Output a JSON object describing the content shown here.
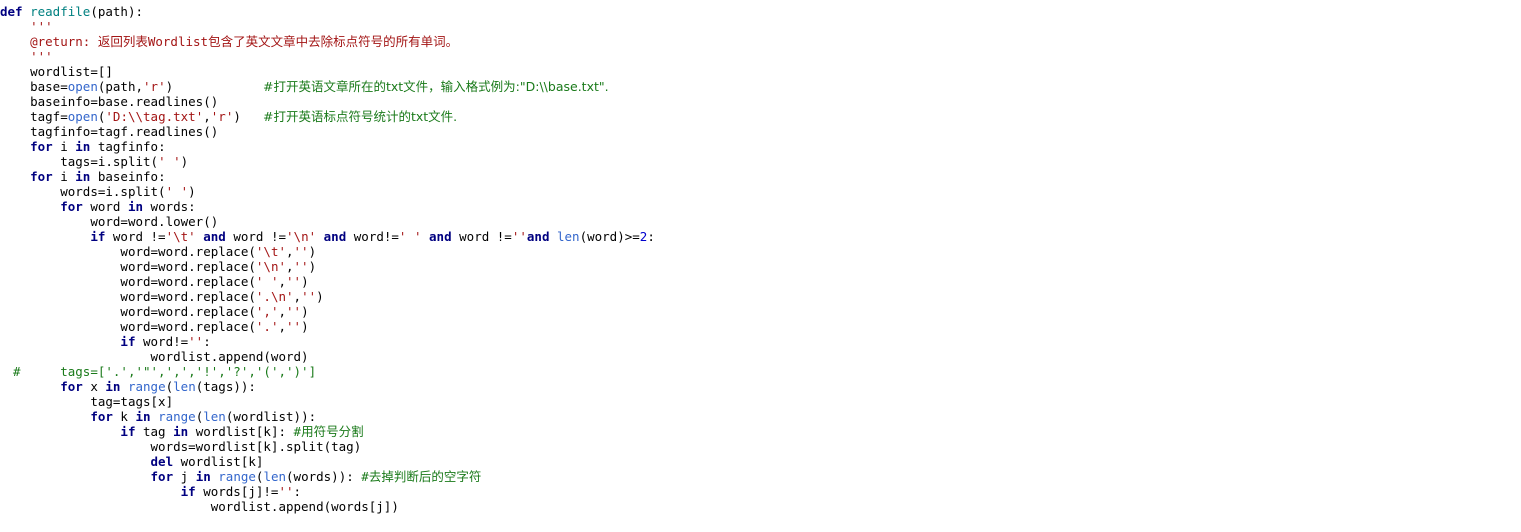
{
  "document": {
    "kind": "python-source-listing",
    "language": "Python",
    "background_color": "#ffffff",
    "colors": {
      "keyword": "#000080",
      "function_name": "#008080",
      "builtin": "#3366cc",
      "string": "#a31515",
      "docstring": "#a31515",
      "comment": "#1a7a1a",
      "number": "#0000cd",
      "plain_text": "#000000"
    }
  },
  "code": {
    "lines": [
      {
        "indent": "",
        "tokens": [
          {
            "t": "def ",
            "c": "kw"
          },
          {
            "t": "readfile",
            "c": "fn"
          },
          {
            "t": "(path):",
            "c": "plain"
          }
        ]
      },
      {
        "indent": "    ",
        "tokens": [
          {
            "t": "'''",
            "c": "doc"
          }
        ]
      },
      {
        "indent": "    ",
        "tokens": [
          {
            "t": "@return: ",
            "c": "doc"
          },
          {
            "t": "返回列表",
            "c": "doc-cn"
          },
          {
            "t": "Wordlist",
            "c": "doc"
          },
          {
            "t": "包含了英文文章中去除标点符号的所有单词。",
            "c": "doc-cn"
          }
        ]
      },
      {
        "indent": "    ",
        "tokens": [
          {
            "t": "'''",
            "c": "doc"
          }
        ]
      },
      {
        "indent": "    ",
        "tokens": [
          {
            "t": "wordlist=[]",
            "c": "plain"
          }
        ]
      },
      {
        "indent": "    ",
        "tokens": [
          {
            "t": "base=",
            "c": "plain"
          },
          {
            "t": "open",
            "c": "builtin"
          },
          {
            "t": "(path,",
            "c": "plain"
          },
          {
            "t": "'r'",
            "c": "str"
          },
          {
            "t": ")",
            "c": "plain"
          }
        ],
        "comment": {
          "text": "#打开英语文章所在的txt文件，输入格式例为:\"D:\\\\base.txt\".",
          "col": "tail-c1"
        }
      },
      {
        "indent": "    ",
        "tokens": [
          {
            "t": "baseinfo=base.readlines()",
            "c": "plain"
          }
        ]
      },
      {
        "indent": "    ",
        "tokens": [
          {
            "t": "tagf=",
            "c": "plain"
          },
          {
            "t": "open",
            "c": "builtin"
          },
          {
            "t": "(",
            "c": "plain"
          },
          {
            "t": "'D:\\\\tag.txt'",
            "c": "str"
          },
          {
            "t": ",",
            "c": "plain"
          },
          {
            "t": "'r'",
            "c": "str"
          },
          {
            "t": ")",
            "c": "plain"
          }
        ],
        "comment": {
          "text": "#打开英语标点符号统计的txt文件.",
          "col": "tail-c2"
        }
      },
      {
        "indent": "    ",
        "tokens": [
          {
            "t": "tagfinfo=tagf.readlines()",
            "c": "plain"
          }
        ]
      },
      {
        "indent": "    ",
        "tokens": [
          {
            "t": "for ",
            "c": "kw"
          },
          {
            "t": "i ",
            "c": "plain"
          },
          {
            "t": "in ",
            "c": "kw"
          },
          {
            "t": "tagfinfo:",
            "c": "plain"
          }
        ]
      },
      {
        "indent": "        ",
        "tokens": [
          {
            "t": "tags=i.split(",
            "c": "plain"
          },
          {
            "t": "' '",
            "c": "str"
          },
          {
            "t": ")",
            "c": "plain"
          }
        ]
      },
      {
        "indent": "    ",
        "tokens": [
          {
            "t": "for ",
            "c": "kw"
          },
          {
            "t": "i ",
            "c": "plain"
          },
          {
            "t": "in ",
            "c": "kw"
          },
          {
            "t": "baseinfo:",
            "c": "plain"
          }
        ]
      },
      {
        "indent": "        ",
        "tokens": [
          {
            "t": "words=i.split(",
            "c": "plain"
          },
          {
            "t": "' '",
            "c": "str"
          },
          {
            "t": ")",
            "c": "plain"
          }
        ]
      },
      {
        "indent": "        ",
        "tokens": [
          {
            "t": "for ",
            "c": "kw"
          },
          {
            "t": "word ",
            "c": "plain"
          },
          {
            "t": "in ",
            "c": "kw"
          },
          {
            "t": "words:",
            "c": "plain"
          }
        ]
      },
      {
        "indent": "            ",
        "tokens": [
          {
            "t": "word=word.lower()",
            "c": "plain"
          }
        ]
      },
      {
        "indent": "            ",
        "tokens": [
          {
            "t": "if ",
            "c": "kw"
          },
          {
            "t": "word !=",
            "c": "plain"
          },
          {
            "t": "'\\t'",
            "c": "str"
          },
          {
            "t": " and ",
            "c": "kw"
          },
          {
            "t": "word !=",
            "c": "plain"
          },
          {
            "t": "'\\n'",
            "c": "str"
          },
          {
            "t": " and ",
            "c": "kw"
          },
          {
            "t": "word!=",
            "c": "plain"
          },
          {
            "t": "' '",
            "c": "str"
          },
          {
            "t": " and ",
            "c": "kw"
          },
          {
            "t": "word !=",
            "c": "plain"
          },
          {
            "t": "''",
            "c": "str"
          },
          {
            "t": "and ",
            "c": "kw"
          },
          {
            "t": "len",
            "c": "builtin"
          },
          {
            "t": "(word)>=",
            "c": "plain"
          },
          {
            "t": "2",
            "c": "num"
          },
          {
            "t": ":",
            "c": "plain"
          }
        ]
      },
      {
        "indent": "                ",
        "tokens": [
          {
            "t": "word=word.replace(",
            "c": "plain"
          },
          {
            "t": "'\\t'",
            "c": "str"
          },
          {
            "t": ",",
            "c": "plain"
          },
          {
            "t": "''",
            "c": "str"
          },
          {
            "t": ")",
            "c": "plain"
          }
        ]
      },
      {
        "indent": "                ",
        "tokens": [
          {
            "t": "word=word.replace(",
            "c": "plain"
          },
          {
            "t": "'\\n'",
            "c": "str"
          },
          {
            "t": ",",
            "c": "plain"
          },
          {
            "t": "''",
            "c": "str"
          },
          {
            "t": ")",
            "c": "plain"
          }
        ]
      },
      {
        "indent": "                ",
        "tokens": [
          {
            "t": "word=word.replace(",
            "c": "plain"
          },
          {
            "t": "' '",
            "c": "str"
          },
          {
            "t": ",",
            "c": "plain"
          },
          {
            "t": "''",
            "c": "str"
          },
          {
            "t": ")",
            "c": "plain"
          }
        ]
      },
      {
        "indent": "                ",
        "tokens": [
          {
            "t": "word=word.replace(",
            "c": "plain"
          },
          {
            "t": "'.\\n'",
            "c": "str"
          },
          {
            "t": ",",
            "c": "plain"
          },
          {
            "t": "''",
            "c": "str"
          },
          {
            "t": ")",
            "c": "plain"
          }
        ]
      },
      {
        "indent": "                ",
        "tokens": [
          {
            "t": "word=word.replace(",
            "c": "plain"
          },
          {
            "t": "','",
            "c": "str"
          },
          {
            "t": ",",
            "c": "plain"
          },
          {
            "t": "''",
            "c": "str"
          },
          {
            "t": ")",
            "c": "plain"
          }
        ]
      },
      {
        "indent": "                ",
        "tokens": [
          {
            "t": "word=word.replace(",
            "c": "plain"
          },
          {
            "t": "'.'",
            "c": "str"
          },
          {
            "t": ",",
            "c": "plain"
          },
          {
            "t": "''",
            "c": "str"
          },
          {
            "t": ")",
            "c": "plain"
          }
        ]
      },
      {
        "indent": "                ",
        "tokens": [
          {
            "t": "if ",
            "c": "kw"
          },
          {
            "t": "word!=",
            "c": "plain"
          },
          {
            "t": "''",
            "c": "str"
          },
          {
            "t": ":",
            "c": "plain"
          }
        ]
      },
      {
        "indent": "                    ",
        "tokens": [
          {
            "t": "wordlist.append(word)",
            "c": "plain"
          }
        ]
      },
      {
        "indent": "        ",
        "gutter_hash": "#",
        "tokens": [
          {
            "t": "tags=[",
            "c": "cmt"
          },
          {
            "t": "'.','\"',',','!','?','(',')'",
            "c": "cmt"
          },
          {
            "t": "]",
            "c": "cmt"
          }
        ]
      },
      {
        "indent": "        ",
        "tokens": [
          {
            "t": "for ",
            "c": "kw"
          },
          {
            "t": "x ",
            "c": "plain"
          },
          {
            "t": "in ",
            "c": "kw"
          },
          {
            "t": "range",
            "c": "builtin"
          },
          {
            "t": "(",
            "c": "plain"
          },
          {
            "t": "len",
            "c": "builtin"
          },
          {
            "t": "(tags)):",
            "c": "plain"
          }
        ]
      },
      {
        "indent": "            ",
        "tokens": [
          {
            "t": "tag=tags[x]",
            "c": "plain"
          }
        ]
      },
      {
        "indent": "            ",
        "tokens": [
          {
            "t": "for ",
            "c": "kw"
          },
          {
            "t": "k ",
            "c": "plain"
          },
          {
            "t": "in ",
            "c": "kw"
          },
          {
            "t": "range",
            "c": "builtin"
          },
          {
            "t": "(",
            "c": "plain"
          },
          {
            "t": "len",
            "c": "builtin"
          },
          {
            "t": "(wordlist)):",
            "c": "plain"
          }
        ]
      },
      {
        "indent": "                ",
        "tokens": [
          {
            "t": "if ",
            "c": "kw"
          },
          {
            "t": "tag ",
            "c": "plain"
          },
          {
            "t": "in ",
            "c": "kw"
          },
          {
            "t": "wordlist[k]: ",
            "c": "plain"
          },
          {
            "t": "#",
            "c": "cmt"
          },
          {
            "t": "用符号分割",
            "c": "cmt-cn"
          }
        ]
      },
      {
        "indent": "                    ",
        "tokens": [
          {
            "t": "words=wordlist[k].split(tag)",
            "c": "plain"
          }
        ]
      },
      {
        "indent": "                    ",
        "tokens": [
          {
            "t": "del ",
            "c": "kw"
          },
          {
            "t": "wordlist[k]",
            "c": "plain"
          }
        ]
      },
      {
        "indent": "                    ",
        "tokens": [
          {
            "t": "for ",
            "c": "kw"
          },
          {
            "t": "j ",
            "c": "plain"
          },
          {
            "t": "in ",
            "c": "kw"
          },
          {
            "t": "range",
            "c": "builtin"
          },
          {
            "t": "(",
            "c": "plain"
          },
          {
            "t": "len",
            "c": "builtin"
          },
          {
            "t": "(words)): ",
            "c": "plain"
          },
          {
            "t": "#",
            "c": "cmt"
          },
          {
            "t": "去掉判断后的空字符",
            "c": "cmt-cn"
          }
        ]
      },
      {
        "indent": "                        ",
        "tokens": [
          {
            "t": "if ",
            "c": "kw"
          },
          {
            "t": "words[j]!=",
            "c": "plain"
          },
          {
            "t": "''",
            "c": "str"
          },
          {
            "t": ":",
            "c": "plain"
          }
        ]
      },
      {
        "indent": "                            ",
        "tokens": [
          {
            "t": "wordlist.append(words[j])",
            "c": "plain"
          }
        ]
      }
    ]
  }
}
